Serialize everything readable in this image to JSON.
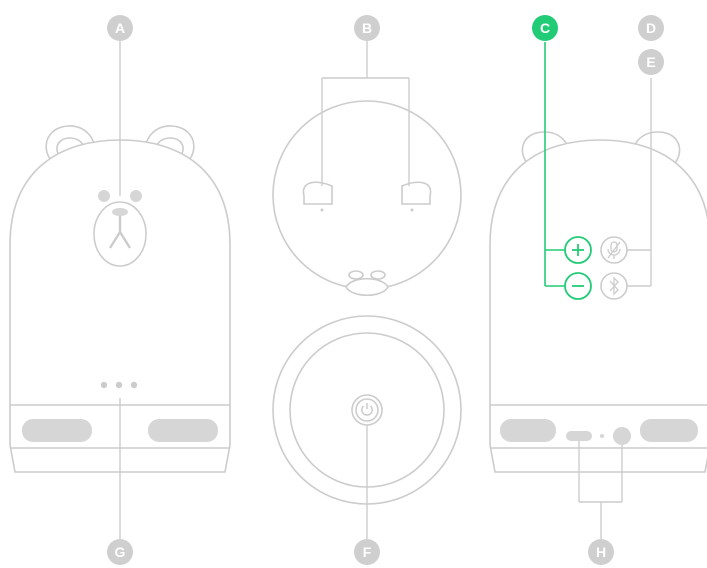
{
  "diagram": {
    "labels": {
      "a": "A",
      "b": "B",
      "c": "C",
      "d": "D",
      "e": "E",
      "f": "F",
      "g": "G",
      "h": "H"
    },
    "colors": {
      "outline": "#cccccc",
      "fill_gray": "#d6d6d6",
      "badge_gray": "#cfcfcf",
      "accent": "#22cc77",
      "background": "#ffffff"
    },
    "icons": {
      "volume_up": "plus-icon",
      "volume_down": "minus-icon",
      "mic_mute": "mic-off-icon",
      "bluetooth": "bluetooth-icon",
      "power": "power-icon"
    }
  }
}
